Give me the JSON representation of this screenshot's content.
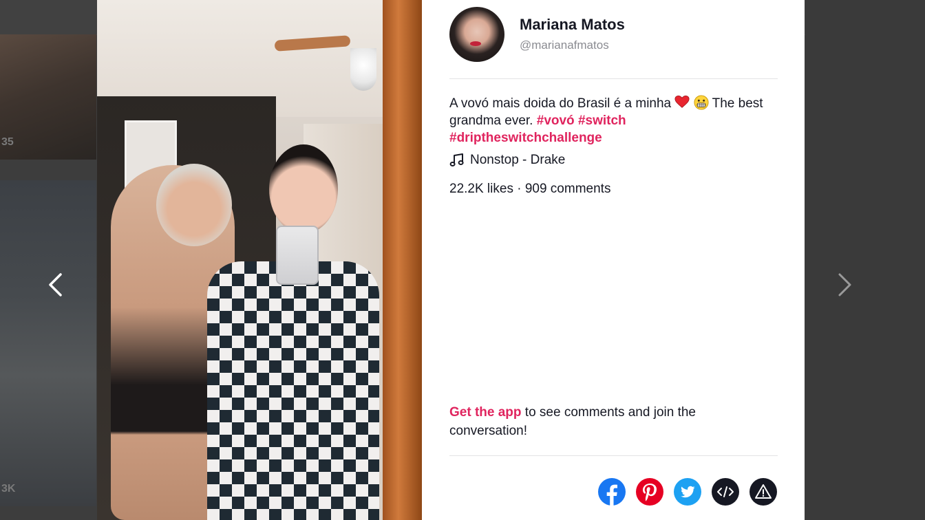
{
  "background": {
    "thumb_counts": [
      "35",
      "3K"
    ]
  },
  "navigation": {
    "prev_icon": "chevron-left-icon",
    "next_icon": "chevron-right-icon"
  },
  "video": {
    "description_icon": "video-frame"
  },
  "author": {
    "name": "Mariana Matos",
    "handle": "@marianafmatos"
  },
  "caption": {
    "text_part1": "A vovó mais doida do Brasil é a minha",
    "text_part2": " The best grandma ever. ",
    "hashtags": [
      "#vovó",
      "#switch",
      "#driptheswitchchallenge"
    ],
    "emojis": [
      "red-heart-emoji",
      "grinning-face-emoji"
    ]
  },
  "music": {
    "icon": "music-note-icon",
    "title": "Nonstop - Drake"
  },
  "stats": {
    "text": "22.2K likes · 909 comments"
  },
  "cta": {
    "link_text": "Get the app",
    "rest_text": " to see comments and join the conversation!"
  },
  "share": {
    "buttons": [
      "facebook-icon",
      "pinterest-icon",
      "twitter-icon",
      "embed-code-icon",
      "report-icon"
    ]
  },
  "colors": {
    "accent": "#e0245e",
    "text": "#161823",
    "muted": "#8a8b91",
    "facebook": "#1877f2",
    "pinterest": "#e60023",
    "twitter": "#1da1f2",
    "dark": "#161823"
  }
}
